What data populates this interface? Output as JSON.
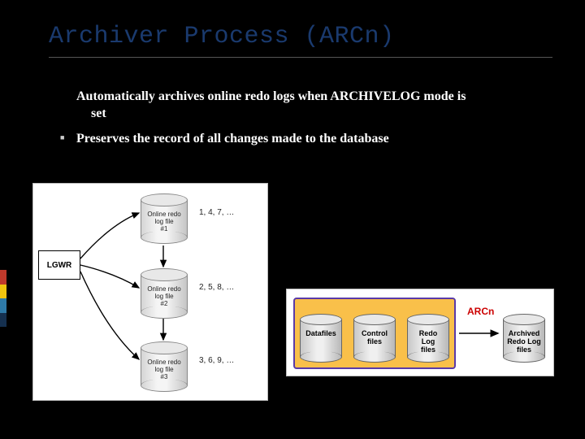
{
  "title": "Archiver Process (ARCn)",
  "bullets": {
    "main_line1": "Automatically archives online redo logs when ARCHIVELOG mode is",
    "main_line2": "set",
    "sub": "Preserves the record of all changes made to the database"
  },
  "left_diagram": {
    "lgwr_label": "LGWR",
    "cylinders": [
      {
        "label_line1": "Online redo",
        "label_line2": "log file",
        "label_line3": "#1",
        "seq": "1, 4, 7, …"
      },
      {
        "label_line1": "Online redo",
        "label_line2": "log file",
        "label_line3": "#2",
        "seq": "2, 5, 8, …"
      },
      {
        "label_line1": "Online redo",
        "label_line2": "log file",
        "label_line3": "#3",
        "seq": "3, 6, 9, …"
      }
    ]
  },
  "right_diagram": {
    "items": [
      {
        "line1": "Datafiles",
        "line2": ""
      },
      {
        "line1": "Control",
        "line2": "files"
      },
      {
        "line1": "Redo",
        "line2": "Log",
        "line3": "files"
      }
    ],
    "arcn_label": "ARCn",
    "archived": {
      "line1": "Archived",
      "line2": "Redo Log",
      "line3": "files"
    }
  },
  "colorbar": [
    "#c0392b",
    "#f1c40f",
    "#2e7aa8",
    "#15304f"
  ]
}
